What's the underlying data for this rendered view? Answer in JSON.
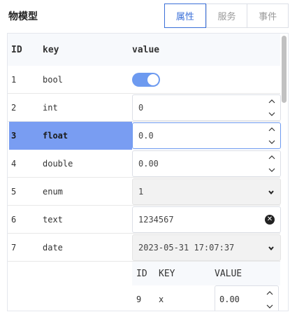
{
  "title": "物模型",
  "tabs": [
    {
      "label": "属性",
      "active": true
    },
    {
      "label": "服务",
      "active": false
    },
    {
      "label": "事件",
      "active": false
    }
  ],
  "table": {
    "headers": {
      "id": "ID",
      "key": "key",
      "value": "value"
    },
    "rows": [
      {
        "id": "1",
        "key": "bool",
        "type": "toggle",
        "value": "on"
      },
      {
        "id": "2",
        "key": "int",
        "type": "number",
        "value": "0"
      },
      {
        "id": "3",
        "key": "float",
        "type": "number",
        "value": "0.0"
      },
      {
        "id": "4",
        "key": "double",
        "type": "number",
        "value": "0.00"
      },
      {
        "id": "5",
        "key": "enum",
        "type": "select",
        "value": "1"
      },
      {
        "id": "6",
        "key": "text",
        "type": "text",
        "value": "1234567"
      },
      {
        "id": "7",
        "key": "date",
        "type": "select",
        "value": "2023-05-31 17:07:37"
      }
    ],
    "nested": {
      "headers": {
        "id": "ID",
        "key": "KEY",
        "value": "VALUE"
      },
      "rows": [
        {
          "id": "9",
          "key": "x",
          "value": "0.00"
        }
      ]
    }
  },
  "colors": {
    "accent": "#3a6fd8",
    "selected_row": "#799df2",
    "toggle_on": "#6d9af0"
  }
}
